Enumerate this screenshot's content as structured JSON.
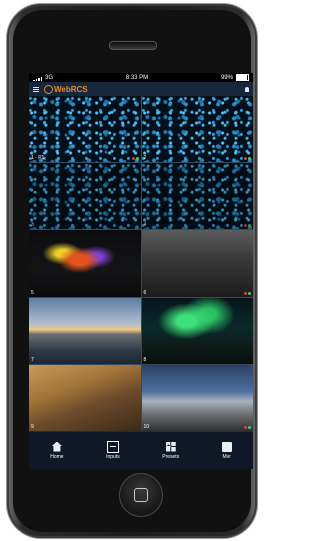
{
  "status_bar": {
    "carrier": "3G",
    "time": "8:33 PM",
    "battery": "99%"
  },
  "app": {
    "logo_text": "WebRCS",
    "accent_color": "#e98b2a"
  },
  "tiles": [
    {
      "number": "1 - P1",
      "style": "bokeh",
      "dots": [
        "#e23b3b",
        "#3bd16b"
      ]
    },
    {
      "number": "2",
      "style": "bokeh",
      "dots": [
        "#e23b3b",
        "#3bd16b"
      ]
    },
    {
      "number": "3",
      "style": "bokeh-dark",
      "dots": []
    },
    {
      "number": "4",
      "style": "bokeh-dark",
      "dots": [
        "#e23b3b",
        "#3bd16b"
      ]
    },
    {
      "number": "5",
      "style": "colorful",
      "dots": []
    },
    {
      "number": "6",
      "style": "street",
      "dots": [
        "#e23b3b",
        "#3bd16b"
      ]
    },
    {
      "number": "7",
      "style": "mountains",
      "dots": []
    },
    {
      "number": "8",
      "style": "aurora",
      "dots": []
    },
    {
      "number": "9",
      "style": "desert",
      "dots": []
    },
    {
      "number": "10",
      "style": "building",
      "dots": [
        "#e23b3b",
        "#3bd16b"
      ]
    }
  ],
  "tabs": [
    {
      "label": "Home",
      "icon": "home-icon"
    },
    {
      "label": "Inputs",
      "icon": "inputs-icon",
      "active": true
    },
    {
      "label": "Presets",
      "icon": "presets-icon"
    },
    {
      "label": "Mvr",
      "icon": "mvr-icon"
    }
  ]
}
